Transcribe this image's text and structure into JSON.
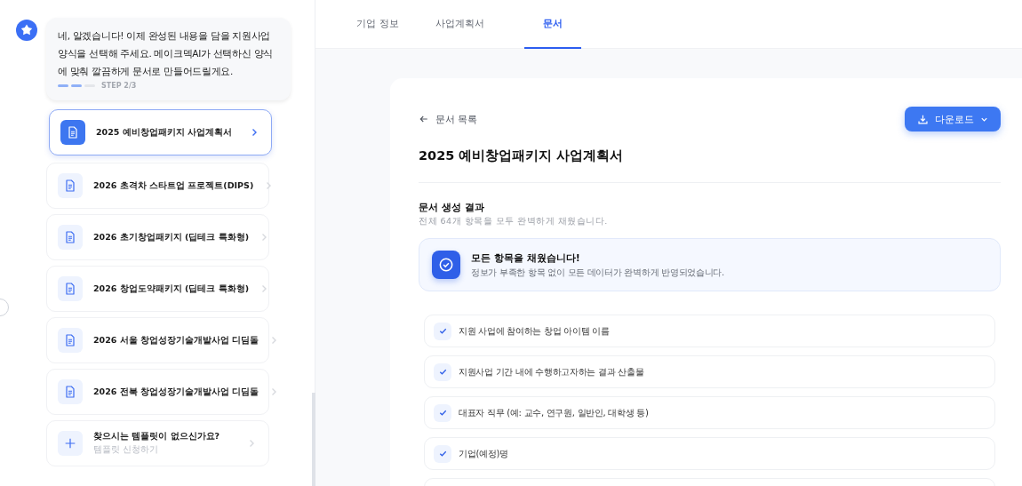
{
  "chat": {
    "message": "네, 알겠습니다! 이제 완성된 내용을 담을 지원사업 양식을 선택해 주세요. 메이크덱AI가 선택하신 양식에 맞춰 깔끔하게 문서로 만들어드릴게요.",
    "steps": [
      {
        "done": true
      },
      {
        "done": true
      },
      {
        "done": false
      }
    ],
    "step_label": "STEP 2/3"
  },
  "templates": [
    {
      "kind": "document",
      "title": "2025 예비창업패키지 사업계획서",
      "selected": true
    },
    {
      "kind": "document",
      "title": "2026 초격차 스타트업 프로젝트(DIPS)",
      "selected": false
    },
    {
      "kind": "document",
      "title": "2026 초기창업패키지 (딥테크 특화형)",
      "selected": false
    },
    {
      "kind": "document",
      "title": "2026 창업도약패키지 (딥테크 특화형)",
      "selected": false
    },
    {
      "kind": "document",
      "title": "2026 서울 창업성장기술개발사업 디딤돌",
      "selected": false
    },
    {
      "kind": "document",
      "title": "2026 전북 창업성장기술개발사업 디딤돌",
      "selected": false
    },
    {
      "kind": "add",
      "title": "찾으시는 템플릿이 없으신가요?",
      "subtitle": "템플릿 신청하기",
      "selected": false
    }
  ],
  "tabs": [
    {
      "label": "기업 정보",
      "selected": false
    },
    {
      "label": "사업계획서",
      "selected": false
    },
    {
      "label": "문서",
      "selected": true
    }
  ],
  "document": {
    "back_link": "문서 목록",
    "download_button": "다운로드",
    "title": "2025 예비창업패키지 사업계획서",
    "section_title": "문서 생성 결과",
    "section_subtitle": "전체 64개 항목을 모두 완벽하게 채웠습니다.",
    "banner": {
      "title": "모든 항목을 채웠습니다!",
      "text": "정보가 부족한 항목 없이 모든 데이터가 완벽하게 반영되었습니다."
    },
    "items": [
      {
        "label": "지원 사업에 참여하는 창업 아이템 이름",
        "checked": true
      },
      {
        "label": "지원사업 기간 내에 수행하고자하는 결과 산출물",
        "checked": true
      },
      {
        "label": "대표자 직무 (예: 교수, 연구원, 일반인, 대학생 등)",
        "checked": true
      },
      {
        "label": "기업(예정)명",
        "checked": true
      }
    ]
  }
}
